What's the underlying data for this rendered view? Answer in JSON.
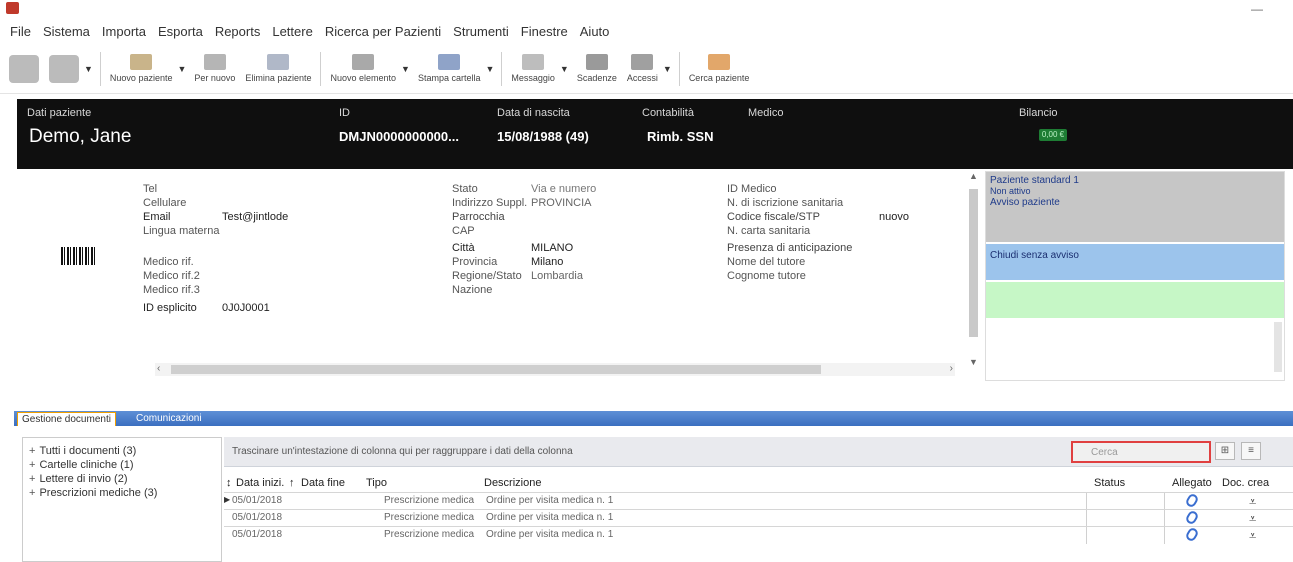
{
  "window": {
    "title": ""
  },
  "menu": [
    "File",
    "Sistema",
    "Importa",
    "Esporta",
    "Reports",
    "Lettere",
    "Ricerca per Pazienti",
    "Strumenti",
    "Finestre",
    "Aiuto"
  ],
  "toolbar": {
    "buttons": [
      {
        "label": "Nuovo paziente"
      },
      {
        "label": "Per nuovo"
      },
      {
        "label": "Elimina paziente"
      },
      {
        "label": "Nuovo elemento"
      },
      {
        "label": "Stampa cartella"
      },
      {
        "label": "Messaggio"
      },
      {
        "label": "Scadenze"
      },
      {
        "label": "Accessi"
      },
      {
        "label": "Cerca paziente"
      }
    ]
  },
  "patient": {
    "header": {
      "label_patient": "Dati paziente",
      "name": "Demo, Jane",
      "label_id": "ID",
      "id": "DMJN0000000000...",
      "label_birth": "Data di nascita",
      "birth": "15/08/1988 (49)",
      "label_contract": "Contabilità",
      "contract": "Rimb. SSN",
      "label_doctor": "Medico",
      "label_balance": "Bilancio",
      "balance_badge": "0,00 €"
    },
    "details": {
      "col1": [
        {
          "label": "Tel",
          "value": ""
        },
        {
          "label": "Cellulare",
          "value": ""
        },
        {
          "label": "Email",
          "value": "Test@jintlode"
        },
        {
          "label": "Lingua materna",
          "value": ""
        },
        {
          "label": "",
          "value": ""
        },
        {
          "label": "Medico rif.",
          "value": ""
        },
        {
          "label": "Medico rif.2",
          "value": ""
        },
        {
          "label": "Medico rif.3",
          "value": ""
        },
        {
          "label": "ID esplicito",
          "value": "0J0J0001"
        }
      ],
      "col2": [
        {
          "label": "Stato",
          "value": "Via e numero"
        },
        {
          "label": "Indirizzo Suppl.",
          "value": "PROVINCIA"
        },
        {
          "label": "Parrocchia",
          "value": ""
        },
        {
          "label": "CAP",
          "value": ""
        },
        {
          "label": "Città",
          "value": "MILANO"
        },
        {
          "label": "Provincia",
          "value": "Milano"
        },
        {
          "label": "Regione/Stato",
          "value": "Lombardia"
        },
        {
          "label": "Nazione",
          "value": ""
        }
      ],
      "col3": [
        {
          "label": "ID Medico",
          "value": ""
        },
        {
          "label": "N. di iscrizione sanitaria",
          "value": ""
        },
        {
          "label": "Codice fiscale/STP",
          "value": "nuovo"
        },
        {
          "label": "N. carta sanitaria",
          "value": ""
        },
        {
          "label": "Presenza di anticipazione",
          "value": ""
        },
        {
          "label": "Nome del tutore",
          "value": ""
        },
        {
          "label": "Cognome tutore",
          "value": ""
        }
      ]
    },
    "side_panel": {
      "lines_gray": [
        "Paziente standard 1",
        "Non attivo",
        "Avviso paziente"
      ],
      "line_blue": "Chiudi senza avviso"
    }
  },
  "tabs": [
    {
      "label": "Gestione documenti"
    },
    {
      "label": "Comunicazioni"
    }
  ],
  "doc_tree": [
    "Tutti i documenti (3)",
    "Cartelle cliniche (1)",
    "Lettere di invio (2)",
    "Prescrizioni mediche (3)"
  ],
  "grid": {
    "filter_text": "Trascinare un'intestazione di colonna qui per raggruppare i dati della colonna",
    "search_placeholder": "Cerca",
    "columns": [
      "Data inizi.",
      "Data fine",
      "Tipo",
      "Descrizione",
      "Status",
      "Allegato",
      "Doc. crea"
    ],
    "rows": [
      {
        "date_start": "05/01/2018",
        "date_end": "",
        "type": "Prescrizione medica",
        "description": "Ordine per visita medica n. 1",
        "status": ""
      },
      {
        "date_start": "05/01/2018",
        "date_end": "",
        "type": "Prescrizione medica",
        "description": "Ordine per visita medica n. 1",
        "status": ""
      },
      {
        "date_start": "05/01/2018",
        "date_end": "",
        "type": "Prescrizione medica",
        "description": "Ordine per visita medica n. 1",
        "status": ""
      }
    ]
  }
}
